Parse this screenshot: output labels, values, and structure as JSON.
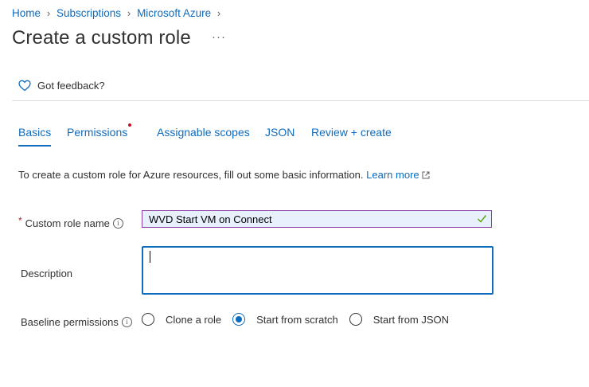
{
  "breadcrumb": [
    {
      "label": "Home"
    },
    {
      "label": "Subscriptions"
    },
    {
      "label": "Microsoft Azure"
    }
  ],
  "page": {
    "title": "Create a custom role",
    "more_label": "···"
  },
  "feedback": {
    "label": "Got feedback?",
    "icon": "heart-icon"
  },
  "tabs": [
    {
      "label": "Basics",
      "active": true
    },
    {
      "label": "Permissions",
      "required_indicator": true
    },
    {
      "label": "Assignable scopes"
    },
    {
      "label": "JSON"
    },
    {
      "label": "Review + create"
    }
  ],
  "intro": {
    "text": "To create a custom role for Azure resources, fill out some basic information.",
    "link": "Learn more"
  },
  "form": {
    "role_name": {
      "required_mark": "*",
      "label": "Custom role name",
      "value": "WVD Start VM on Connect",
      "valid": true
    },
    "description": {
      "label": "Description",
      "value": ""
    },
    "baseline": {
      "label": "Baseline permissions",
      "options": [
        {
          "label": "Clone a role",
          "selected": false
        },
        {
          "label": "Start from scratch",
          "selected": true
        },
        {
          "label": "Start from JSON",
          "selected": false
        }
      ]
    }
  },
  "colors": {
    "accent": "#0f6cbd",
    "required": "#c50f1f",
    "valid": "#57a300",
    "input_focus": "#8a3ea3"
  }
}
